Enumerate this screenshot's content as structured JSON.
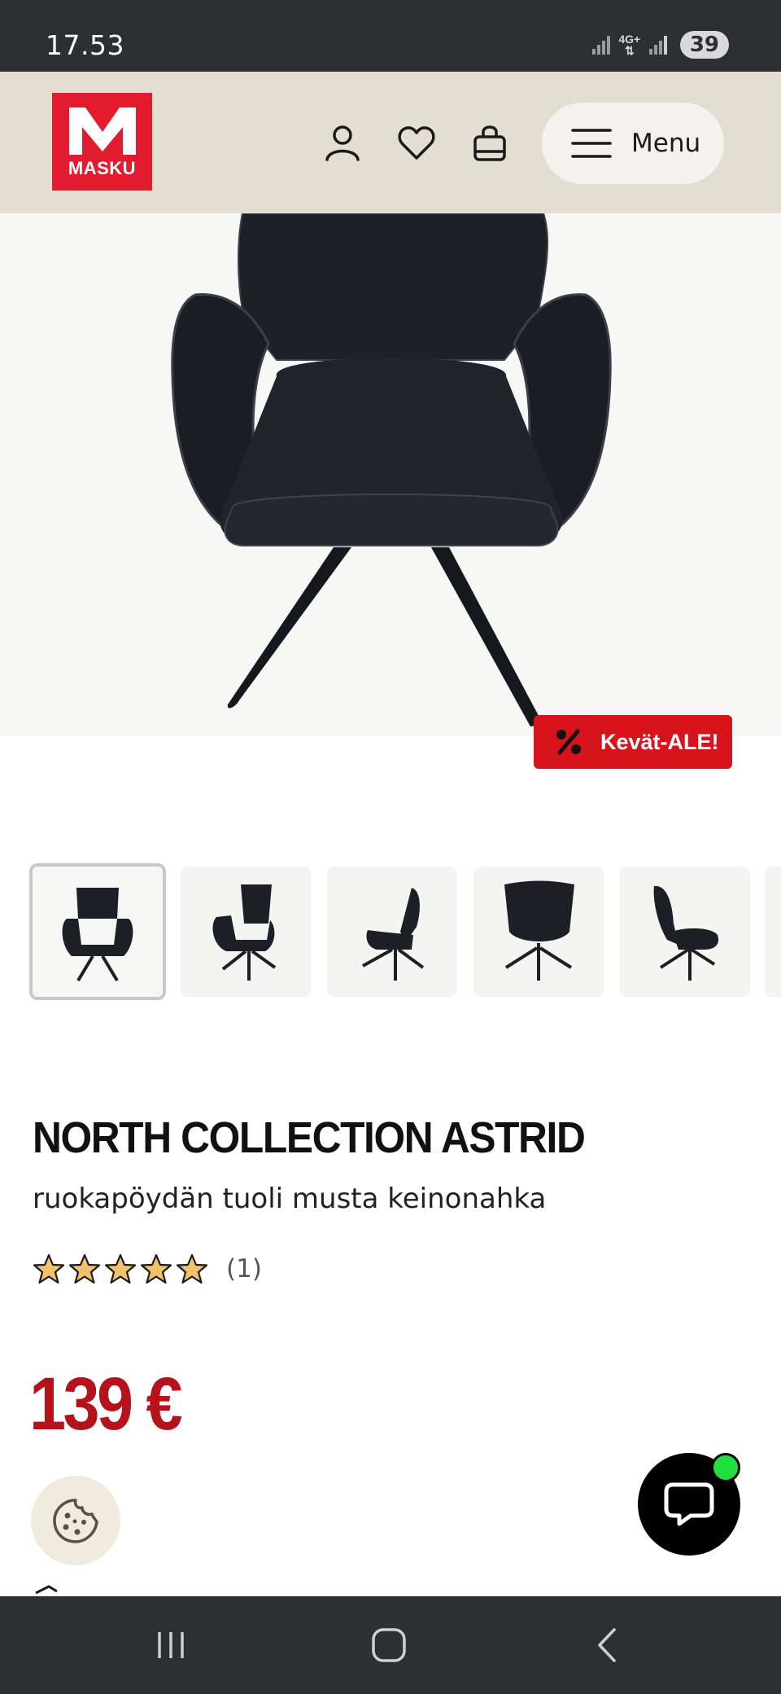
{
  "status_bar": {
    "time": "17.53",
    "network": "4G+",
    "battery": "39"
  },
  "header": {
    "logo_text": "MASKU",
    "menu_label": "Menu"
  },
  "hero": {
    "badge_label": "Kevät-ALE!",
    "badge_color": "#d7141c"
  },
  "thumbnails": {
    "count": 6,
    "selected_index": 0
  },
  "product": {
    "title": "NORTH COLLECTION ASTRID",
    "subtitle": "ruokapöydän tuoli musta keinonahka",
    "rating": 5,
    "rating_max": 5,
    "review_count": "(1)",
    "price": "139 €",
    "price_color": "#b5121b"
  },
  "colors": {
    "brand_red": "#e31b2e",
    "header_bg": "#e3ded2",
    "chat_online": "#22e03c"
  }
}
